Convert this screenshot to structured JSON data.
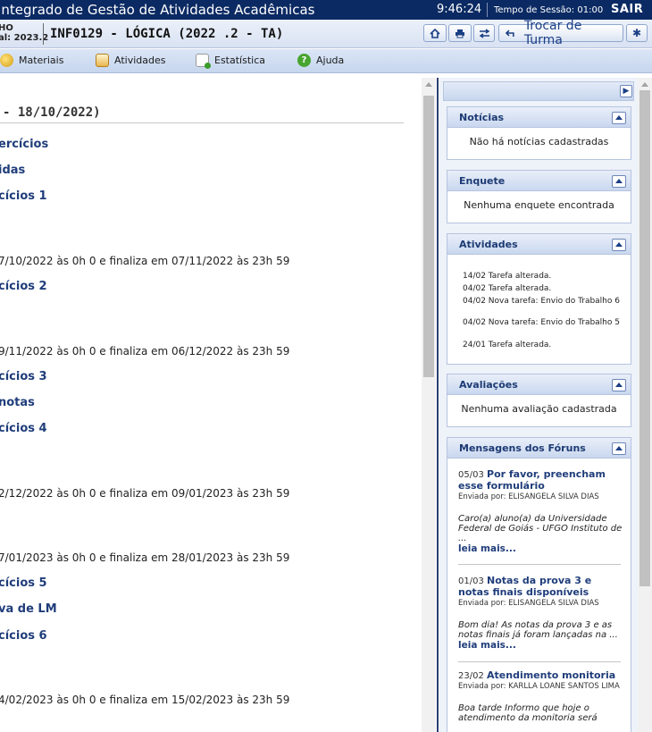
{
  "topbar": {
    "system_title": "Integrado de Gestão de Atividades Acadêmicas",
    "clock": "9:46:24",
    "session_label": "Tempo de Sessão:",
    "session_time": "01:00",
    "logout": "SAIR"
  },
  "course": {
    "user_line1": "HO",
    "user_line2": "al: 2023.2",
    "title": "INF0129 - LÓGICA (2022 .2 - TA)",
    "switch_label": "Trocar de Turma"
  },
  "menu": {
    "materiais": "Materiais",
    "atividades": "Atividades",
    "estatistica": "Estatística",
    "ajuda": "Ajuda"
  },
  "main": {
    "period": "- 18/10/2022)",
    "items": [
      {
        "kind": "link",
        "text": "ercícios"
      },
      {
        "kind": "link",
        "text": "idas"
      },
      {
        "kind": "link",
        "text": "cícios 1"
      },
      {
        "kind": "text",
        "text": "7/10/2022 às 0h 0 e finaliza em 07/11/2022 às 23h 59"
      },
      {
        "kind": "link",
        "text": "cícios 2"
      },
      {
        "kind": "text",
        "text": "9/11/2022 às 0h 0 e finaliza em 06/12/2022 às 23h 59"
      },
      {
        "kind": "link",
        "text": "cícios 3"
      },
      {
        "kind": "link",
        "text": "notas"
      },
      {
        "kind": "link",
        "text": "cícios 4"
      },
      {
        "kind": "text",
        "text": "2/12/2022 às 0h 0 e finaliza em 09/01/2023 às 23h 59"
      },
      {
        "kind": "text",
        "text": "7/01/2023 às 0h 0 e finaliza em 28/01/2023 às 23h 59"
      },
      {
        "kind": "link",
        "text": "cícios 5"
      },
      {
        "kind": "link",
        "text": "va de LM"
      },
      {
        "kind": "link",
        "text": "cícios 6"
      },
      {
        "kind": "text",
        "text": "4/02/2023 às 0h 0 e finaliza em 15/02/2023 às 23h 59"
      }
    ]
  },
  "sidebar": {
    "noticias": {
      "title": "Notícias",
      "empty": "Não há notícias cadastradas"
    },
    "enquete": {
      "title": "Enquete",
      "empty": "Nenhuma enquete encontrada"
    },
    "atividades": {
      "title": "Atividades",
      "items": [
        "14/02 Tarefa alterada.",
        "04/02 Tarefa alterada.",
        "04/02 Nova tarefa: Envio do Trabalho 6",
        "04/02 Nova tarefa: Envio do Trabalho 5",
        "24/01 Tarefa alterada."
      ]
    },
    "avaliacoes": {
      "title": "Avaliações",
      "empty": "Nenhuma avaliação cadastrada"
    },
    "forum": {
      "title": "Mensagens dos Fóruns",
      "messages": [
        {
          "date": "05/03",
          "title": "Por favor, preencham esse formulário",
          "by": "Enviada por: ELISANGELA SILVA DIAS",
          "body": "Caro(a) aluno(a) da Universidade Federal de Goiás - UFGO Instituto de ...",
          "more": "leia mais..."
        },
        {
          "date": "01/03",
          "title": "Notas da prova 3 e notas finais disponíveis",
          "by": "Enviada por: ELISANGELA SILVA DIAS",
          "body": "Bom dia!   As notas da prova 3 e as notas finais já foram lançadas na ...",
          "more": "leia mais..."
        },
        {
          "date": "23/02",
          "title": "Atendimento monitoria",
          "by": "Enviada por: KARLLA LOANE SANTOS LIMA",
          "body": "Boa tarde Informo que hoje o atendimento da monitoria será",
          "more": ""
        }
      ]
    }
  }
}
